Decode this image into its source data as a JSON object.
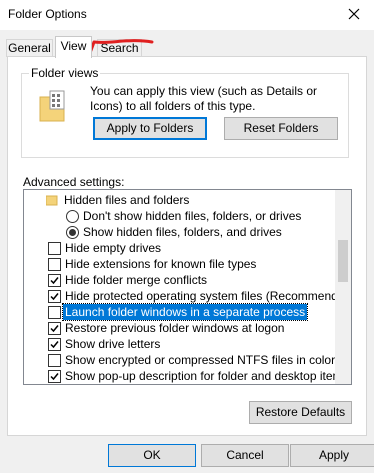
{
  "window": {
    "title": "Folder Options"
  },
  "tabs": [
    {
      "label": "General",
      "active": false
    },
    {
      "label": "View",
      "active": true
    },
    {
      "label": "Search",
      "active": false
    }
  ],
  "folder_views": {
    "legend": "Folder views",
    "description": "You can apply this view (such as Details or Icons) to all folders of this type.",
    "apply_button": "Apply to Folders",
    "reset_button": "Reset Folders"
  },
  "advanced": {
    "label": "Advanced settings:",
    "items": [
      {
        "type": "folder",
        "label": "Hidden files and folders"
      },
      {
        "type": "radio",
        "label": "Don't show hidden files, folders, or drives",
        "checked": false
      },
      {
        "type": "radio",
        "label": "Show hidden files, folders, and drives",
        "checked": true
      },
      {
        "type": "checkbox",
        "label": "Hide empty drives",
        "checked": false
      },
      {
        "type": "checkbox",
        "label": "Hide extensions for known file types",
        "checked": false
      },
      {
        "type": "checkbox",
        "label": "Hide folder merge conflicts",
        "checked": true
      },
      {
        "type": "checkbox",
        "label": "Hide protected operating system files (Recommended)",
        "checked": true
      },
      {
        "type": "checkbox",
        "label": "Launch folder windows in a separate process",
        "checked": false,
        "selected": true
      },
      {
        "type": "checkbox",
        "label": "Restore previous folder windows at logon",
        "checked": true
      },
      {
        "type": "checkbox",
        "label": "Show drive letters",
        "checked": true
      },
      {
        "type": "checkbox",
        "label": "Show encrypted or compressed NTFS files in color",
        "checked": false
      },
      {
        "type": "checkbox",
        "label": "Show pop-up description for folder and desktop items",
        "checked": true
      }
    ],
    "restore_button": "Restore Defaults"
  },
  "footer": {
    "ok": "OK",
    "cancel": "Cancel",
    "apply": "Apply"
  },
  "colors": {
    "accent": "#0078d7",
    "annotation": "#e02020",
    "folder": "#f4d37a"
  },
  "icons": {
    "close": "close-icon",
    "folder_views": "folder-view-icon",
    "tree_folder": "folder-icon",
    "annotation": "red-arrow-annotation"
  }
}
